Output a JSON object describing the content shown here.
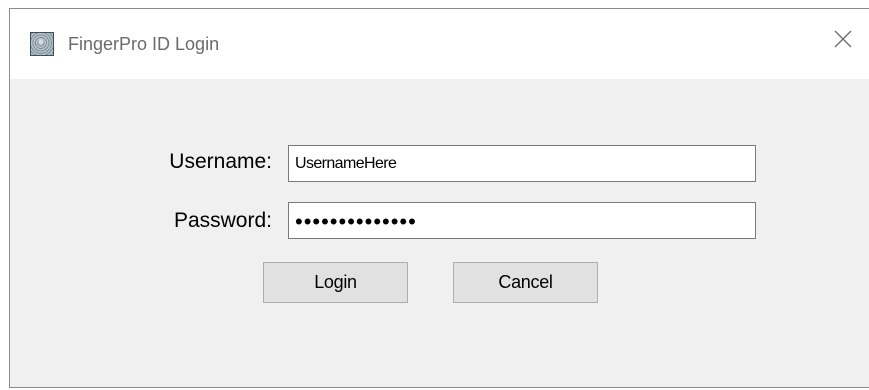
{
  "window": {
    "title": "FingerPro ID Login",
    "icon": "fingerprint-icon",
    "close_icon": "close-icon"
  },
  "form": {
    "username_label": "Username:",
    "username_value": "UsernameHere",
    "password_label": "Password:",
    "password_value": "••••••••••••••",
    "login_label": "Login",
    "cancel_label": "Cancel"
  },
  "colors": {
    "dialog_background": "#f0f0f0",
    "titlebar_background": "#ffffff",
    "button_background": "#e1e1e1"
  }
}
